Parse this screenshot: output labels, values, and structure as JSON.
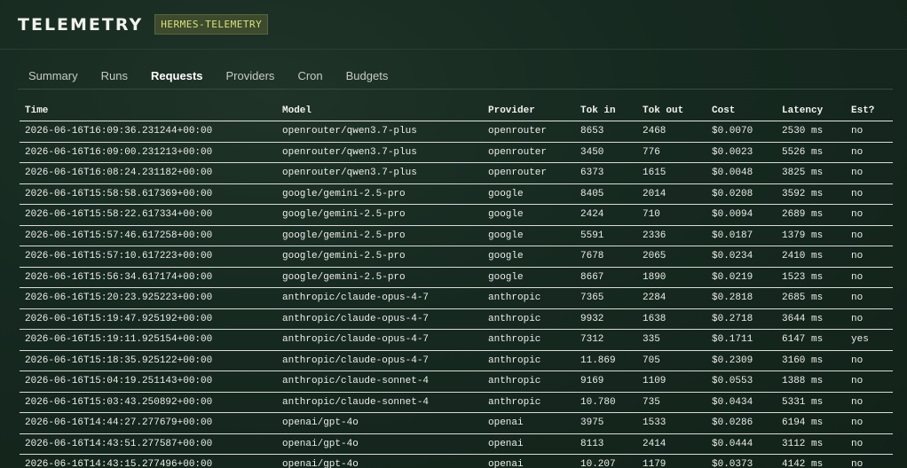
{
  "header": {
    "title": "TELEMETRY",
    "badge": "HERMES-TELEMETRY"
  },
  "tabs": [
    {
      "label": "Summary",
      "active": false
    },
    {
      "label": "Runs",
      "active": false
    },
    {
      "label": "Requests",
      "active": true
    },
    {
      "label": "Providers",
      "active": false
    },
    {
      "label": "Cron",
      "active": false
    },
    {
      "label": "Budgets",
      "active": false
    }
  ],
  "table": {
    "columns": [
      "Time",
      "Model",
      "Provider",
      "Tok in",
      "Tok out",
      "Cost",
      "Latency",
      "Est?"
    ],
    "rows": [
      [
        "2026-06-16T16:09:36.231244+00:00",
        "openrouter/qwen3.7-plus",
        "openrouter",
        "8653",
        "2468",
        "$0.0070",
        "2530 ms",
        "no"
      ],
      [
        "2026-06-16T16:09:00.231213+00:00",
        "openrouter/qwen3.7-plus",
        "openrouter",
        "3450",
        "776",
        "$0.0023",
        "5526 ms",
        "no"
      ],
      [
        "2026-06-16T16:08:24.231182+00:00",
        "openrouter/qwen3.7-plus",
        "openrouter",
        "6373",
        "1615",
        "$0.0048",
        "3825 ms",
        "no"
      ],
      [
        "2026-06-16T15:58:58.617369+00:00",
        "google/gemini-2.5-pro",
        "google",
        "8405",
        "2014",
        "$0.0208",
        "3592 ms",
        "no"
      ],
      [
        "2026-06-16T15:58:22.617334+00:00",
        "google/gemini-2.5-pro",
        "google",
        "2424",
        "710",
        "$0.0094",
        "2689 ms",
        "no"
      ],
      [
        "2026-06-16T15:57:46.617258+00:00",
        "google/gemini-2.5-pro",
        "google",
        "5591",
        "2336",
        "$0.0187",
        "1379 ms",
        "no"
      ],
      [
        "2026-06-16T15:57:10.617223+00:00",
        "google/gemini-2.5-pro",
        "google",
        "7678",
        "2065",
        "$0.0234",
        "2410 ms",
        "no"
      ],
      [
        "2026-06-16T15:56:34.617174+00:00",
        "google/gemini-2.5-pro",
        "google",
        "8667",
        "1890",
        "$0.0219",
        "1523 ms",
        "no"
      ],
      [
        "2026-06-16T15:20:23.925223+00:00",
        "anthropic/claude-opus-4-7",
        "anthropic",
        "7365",
        "2284",
        "$0.2818",
        "2685 ms",
        "no"
      ],
      [
        "2026-06-16T15:19:47.925192+00:00",
        "anthropic/claude-opus-4-7",
        "anthropic",
        "9932",
        "1638",
        "$0.2718",
        "3644 ms",
        "no"
      ],
      [
        "2026-06-16T15:19:11.925154+00:00",
        "anthropic/claude-opus-4-7",
        "anthropic",
        "7312",
        "335",
        "$0.1711",
        "6147 ms",
        "yes"
      ],
      [
        "2026-06-16T15:18:35.925122+00:00",
        "anthropic/claude-opus-4-7",
        "anthropic",
        "11.869",
        "705",
        "$0.2309",
        "3160 ms",
        "no"
      ],
      [
        "2026-06-16T15:04:19.251143+00:00",
        "anthropic/claude-sonnet-4",
        "anthropic",
        "9169",
        "1109",
        "$0.0553",
        "1388 ms",
        "no"
      ],
      [
        "2026-06-16T15:03:43.250892+00:00",
        "anthropic/claude-sonnet-4",
        "anthropic",
        "10.780",
        "735",
        "$0.0434",
        "5331 ms",
        "no"
      ],
      [
        "2026-06-16T14:44:27.277679+00:00",
        "openai/gpt-4o",
        "openai",
        "3975",
        "1533",
        "$0.0286",
        "6194 ms",
        "no"
      ],
      [
        "2026-06-16T14:43:51.277587+00:00",
        "openai/gpt-4o",
        "openai",
        "8113",
        "2414",
        "$0.0444",
        "3112 ms",
        "no"
      ],
      [
        "2026-06-16T14:43:15.277496+00:00",
        "openai/gpt-4o",
        "openai",
        "10.207",
        "1179",
        "$0.0373",
        "4142 ms",
        "no"
      ]
    ]
  }
}
